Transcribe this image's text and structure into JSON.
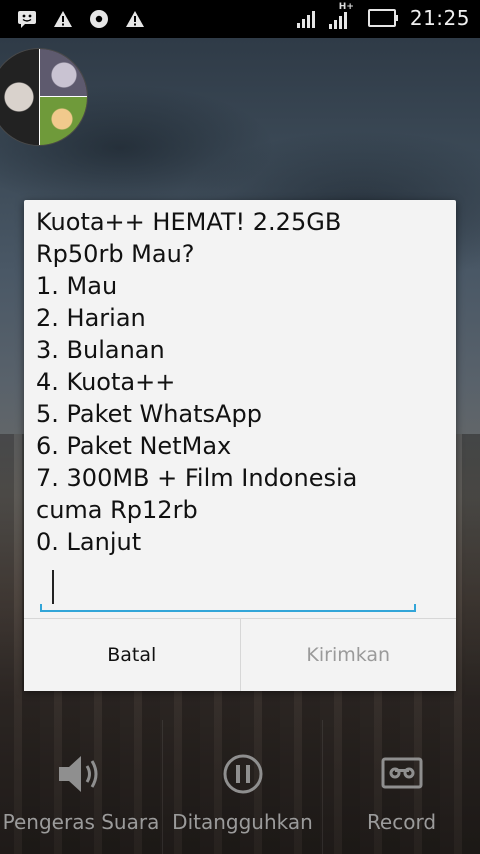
{
  "status_bar": {
    "left_icons": [
      "bbm-icon",
      "warning-icon",
      "sync-icon",
      "warning-icon"
    ],
    "network": "H+",
    "time": "21:25"
  },
  "dialog": {
    "message_lines": [
      "Kuota++ HEMAT! 2.25GB",
      "Rp50rb Mau?",
      "1. Mau",
      "2. Harian",
      "3. Bulanan",
      "4. Kuota++",
      "5. Paket WhatsApp",
      "6. Paket NetMax",
      "7. 300MB + Film Indonesia",
      "cuma Rp12rb",
      "0. Lanjut"
    ],
    "input_value": "",
    "cancel_label": "Batal",
    "send_label": "Kirimkan"
  },
  "controls": {
    "speaker_label": "Pengeras Suara",
    "hold_label": "Ditangguhkan",
    "record_label": "Record"
  },
  "colors": {
    "accent": "#32a5d8",
    "dialog_bg": "#f3f3f3",
    "disabled_text": "#9a9a9a",
    "control_text": "#9b9b9b"
  }
}
